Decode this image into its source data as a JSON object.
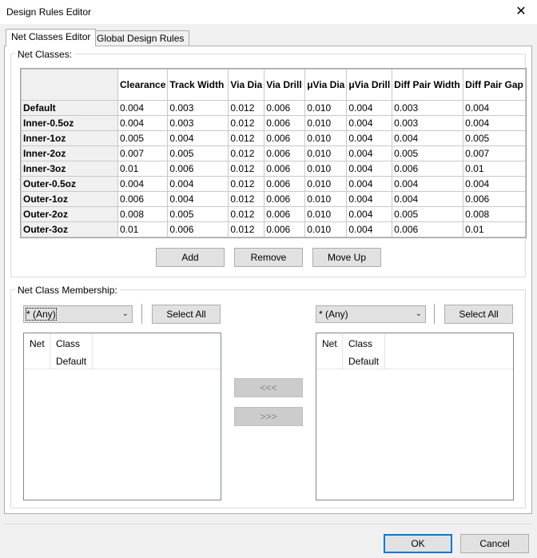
{
  "window": {
    "title": "Design Rules Editor",
    "close_glyph": "✕"
  },
  "tabs": [
    {
      "label": "Net Classes Editor",
      "active": true
    },
    {
      "label": "Global Design Rules",
      "active": false
    }
  ],
  "net_classes": {
    "group_label": "Net Classes:",
    "columns": [
      "Clearance",
      "Track Width",
      "Via Dia",
      "Via Drill",
      "μVia Dia",
      "μVia Drill",
      "Diff Pair Width",
      "Diff Pair Gap"
    ],
    "rows": [
      {
        "name": "Default",
        "values": [
          "0.004",
          "0.003",
          "0.012",
          "0.006",
          "0.010",
          "0.004",
          "0.003",
          "0.004"
        ]
      },
      {
        "name": "Inner-0.5oz",
        "values": [
          "0.004",
          "0.003",
          "0.012",
          "0.006",
          "0.010",
          "0.004",
          "0.003",
          "0.004"
        ]
      },
      {
        "name": "Inner-1oz",
        "values": [
          "0.005",
          "0.004",
          "0.012",
          "0.006",
          "0.010",
          "0.004",
          "0.004",
          "0.005"
        ]
      },
      {
        "name": "Inner-2oz",
        "values": [
          "0.007",
          "0.005",
          "0.012",
          "0.006",
          "0.010",
          "0.004",
          "0.005",
          "0.007"
        ]
      },
      {
        "name": "Inner-3oz",
        "values": [
          "0.01",
          "0.006",
          "0.012",
          "0.006",
          "0.010",
          "0.004",
          "0.006",
          "0.01"
        ]
      },
      {
        "name": "Outer-0.5oz",
        "values": [
          "0.004",
          "0.004",
          "0.012",
          "0.006",
          "0.010",
          "0.004",
          "0.004",
          "0.004"
        ]
      },
      {
        "name": "Outer-1oz",
        "values": [
          "0.006",
          "0.004",
          "0.012",
          "0.006",
          "0.010",
          "0.004",
          "0.004",
          "0.006"
        ]
      },
      {
        "name": "Outer-2oz",
        "values": [
          "0.008",
          "0.005",
          "0.012",
          "0.006",
          "0.010",
          "0.004",
          "0.005",
          "0.008"
        ]
      },
      {
        "name": "Outer-3oz",
        "values": [
          "0.01",
          "0.006",
          "0.012",
          "0.006",
          "0.010",
          "0.004",
          "0.006",
          "0.01"
        ]
      }
    ],
    "buttons": {
      "add": "Add",
      "remove": "Remove",
      "move_up": "Move Up"
    }
  },
  "membership": {
    "group_label": "Net Class Membership:",
    "left": {
      "filter_value": "* (Any)",
      "select_all": "Select All",
      "columns": {
        "net": "Net",
        "class": "Class"
      },
      "class_sub": "Default"
    },
    "right": {
      "filter_value": "* (Any)",
      "select_all": "Select All",
      "columns": {
        "net": "Net",
        "class": "Class"
      },
      "class_sub": "Default"
    },
    "move_left": "<<<",
    "move_right": ">>>"
  },
  "footer": {
    "ok": "OK",
    "cancel": "Cancel"
  }
}
